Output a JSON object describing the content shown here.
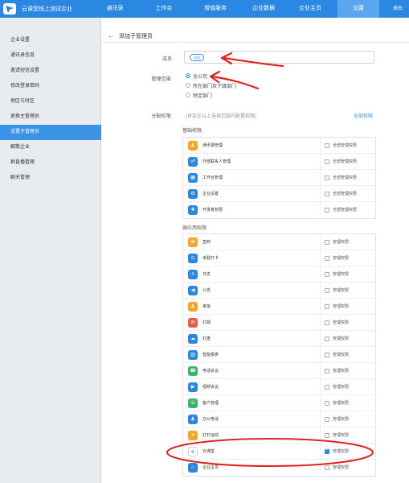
{
  "topbar": {
    "company": "云课堂线上测试企业",
    "logout": "退出",
    "nav": [
      {
        "label": "通讯录"
      },
      {
        "label": "工作台"
      },
      {
        "label": "增值服务"
      },
      {
        "label": "企业数据"
      },
      {
        "label": "企业主页"
      },
      {
        "label": "设置",
        "active": true
      }
    ]
  },
  "sidebar": {
    "items": [
      {
        "label": "企业设置"
      },
      {
        "label": "通讯录信息"
      },
      {
        "label": "邀请短信设置"
      },
      {
        "label": "修改登录密码"
      },
      {
        "label": "地区与时区"
      },
      {
        "label": "更换主管理员"
      },
      {
        "label": "设置子管理员",
        "active": true
      },
      {
        "label": "解散企业"
      },
      {
        "label": "群直播管理"
      },
      {
        "label": "聊天管理"
      }
    ]
  },
  "main": {
    "title": "添加子管理员",
    "member": {
      "label": "成员",
      "add_button": "添加"
    },
    "scope": {
      "label": "管理范围:",
      "options": [
        {
          "label": "全公司",
          "selected": true
        },
        {
          "label": "所在部门及下级部门",
          "selected": false
        },
        {
          "label": "特定部门",
          "selected": false
        }
      ]
    },
    "permissions": {
      "label": "分配权限:",
      "hint": "(将会在以上选择范围内配置权限)",
      "select_all": "全部权限"
    },
    "basic": {
      "title": "基础权限",
      "rows": [
        {
          "label": "通讯录管理",
          "perm": "全部管理权限",
          "icon": "contacts-icon",
          "color": "#f5a623",
          "glyph": "♟",
          "checked": false
        },
        {
          "label": "外部联系人管理",
          "perm": "全部管理权限",
          "icon": "external-contacts-icon",
          "color": "#2a87e2",
          "glyph": "☍",
          "checked": false
        },
        {
          "label": "工作台管理",
          "perm": "全部管理权限",
          "icon": "workbench-icon",
          "color": "#2a87e2",
          "glyph": "▦",
          "checked": false
        },
        {
          "label": "企业设置",
          "perm": "全部管理权限",
          "icon": "settings-icon",
          "color": "#2a87e2",
          "glyph": "⚙",
          "checked": false
        },
        {
          "label": "开发者权限",
          "perm": "全部管理权限",
          "icon": "developer-icon",
          "color": "#2a87e2",
          "glyph": "✚",
          "checked": false
        }
      ]
    },
    "micro": {
      "title": "微应用权限",
      "rows": [
        {
          "label": "签到",
          "perm": "管理权限",
          "icon": "checkin-icon",
          "color": "#f5a623",
          "glyph": "✿",
          "checked": false
        },
        {
          "label": "考勤打卡",
          "perm": "管理权限",
          "icon": "attendance-icon",
          "color": "#2a87e2",
          "glyph": "⊙",
          "checked": false
        },
        {
          "label": "日志",
          "perm": "管理权限",
          "icon": "log-icon",
          "color": "#2a87e2",
          "glyph": "≡",
          "checked": false
        },
        {
          "label": "公告",
          "perm": "管理权限",
          "icon": "announcement-icon",
          "color": "#2a87e2",
          "glyph": "◀",
          "checked": false
        },
        {
          "label": "审批",
          "perm": "管理权限",
          "icon": "approval-icon",
          "color": "#f5a623",
          "glyph": "♟",
          "checked": false
        },
        {
          "label": "钉邮",
          "perm": "管理权限",
          "icon": "mail-icon",
          "color": "#e85a4f",
          "glyph": "✉",
          "checked": false
        },
        {
          "label": "钉盘",
          "perm": "管理权限",
          "icon": "disk-icon",
          "color": "#2a87e2",
          "glyph": "☁",
          "checked": false
        },
        {
          "label": "智能报表",
          "perm": "管理权限",
          "icon": "report-icon",
          "color": "#2a87e2",
          "glyph": "▥",
          "checked": false
        },
        {
          "label": "电话会议",
          "perm": "管理权限",
          "icon": "phone-meeting-icon",
          "color": "#3bb36b",
          "glyph": "☎",
          "checked": false
        },
        {
          "label": "视频会议",
          "perm": "管理权限",
          "icon": "video-meeting-icon",
          "color": "#2a87e2",
          "glyph": "▶",
          "checked": false
        },
        {
          "label": "客户管理",
          "perm": "管理权限",
          "icon": "crm-icon",
          "color": "#3bb36b",
          "glyph": "☏",
          "checked": false
        },
        {
          "label": "办公电话",
          "perm": "管理权限",
          "icon": "office-phone-icon",
          "color": "#2a87e2",
          "glyph": "♟",
          "checked": false
        },
        {
          "label": "钉钉运动",
          "perm": "管理权限",
          "icon": "sports-icon",
          "color": "#f5a623",
          "glyph": "✦",
          "checked": false
        },
        {
          "label": "云课堂",
          "perm": "管理权限",
          "icon": "cloud-class-icon",
          "color": "#ffffff",
          "glyph": "✢",
          "checked": true
        },
        {
          "label": "企业主页",
          "perm": "管理权限",
          "icon": "company-homepage-icon",
          "color": "#2a87e2",
          "glyph": "⌂",
          "checked": false
        }
      ]
    }
  },
  "annotations": {
    "color": "#e0231c"
  }
}
